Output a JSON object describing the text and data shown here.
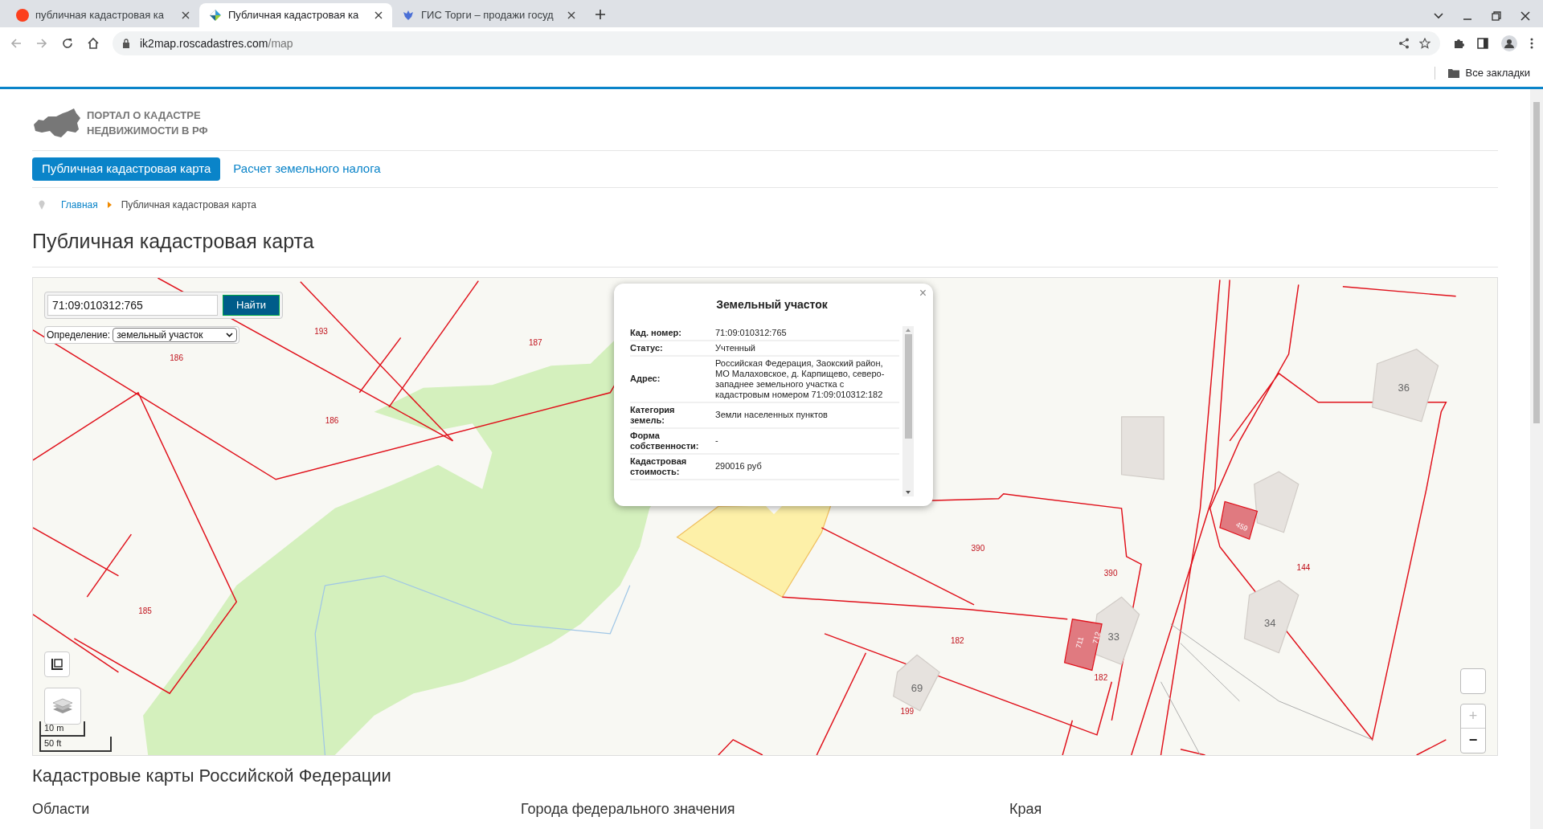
{
  "browser": {
    "tabs": [
      {
        "title": "публичная кадастровая ка",
        "selected": false,
        "kind": "ya"
      },
      {
        "title": "Публичная кадастровая ка",
        "selected": true,
        "kind": "pkk"
      },
      {
        "title": "ГИС Торги – продажи госуд",
        "selected": false,
        "kind": "gis"
      }
    ],
    "url_host": "ik2map.roscadastres.com",
    "url_path": "/map",
    "bookmarks_label": "Все закладки"
  },
  "logo": {
    "line1": "ПОРТАЛ О КАДАСТРЕ",
    "line2": "НЕДВИЖИМОСТИ В РФ"
  },
  "nav": [
    {
      "label": "Публичная кадастровая карта",
      "selected": true
    },
    {
      "label": "Расчет земельного налога",
      "selected": false
    }
  ],
  "breadcrumb": {
    "home": "Главная",
    "current": "Публичная кадастровая карта"
  },
  "page_title": "Публичная кадастровая карта",
  "map": {
    "search": {
      "value": "71:09:010312:765",
      "button": "Найти"
    },
    "definition": {
      "label": "Определение:",
      "value": "земельный участок"
    },
    "labels": [
      {
        "text": "193",
        "kind": "parcel"
      },
      {
        "text": "186",
        "kind": "parcel"
      },
      {
        "text": "187",
        "kind": "parcel"
      },
      {
        "text": "186",
        "kind": "parcel"
      },
      {
        "text": "185",
        "kind": "parcel"
      },
      {
        "text": "390",
        "kind": "parcel"
      },
      {
        "text": "390",
        "kind": "parcel"
      },
      {
        "text": "144",
        "kind": "parcel"
      },
      {
        "text": "182",
        "kind": "parcel"
      },
      {
        "text": "182",
        "kind": "parcel"
      },
      {
        "text": "199",
        "kind": "parcel"
      },
      {
        "text": "69",
        "kind": "building"
      },
      {
        "text": "33",
        "kind": "building"
      },
      {
        "text": "34",
        "kind": "building"
      },
      {
        "text": "36",
        "kind": "building"
      },
      {
        "text": "459",
        "kind": "object"
      },
      {
        "text": "711",
        "kind": "object"
      },
      {
        "text": "712",
        "kind": "object"
      }
    ],
    "scale": {
      "metric": "10 m",
      "imperial": "50 ft"
    },
    "zoom_in": "+",
    "zoom_out": "−",
    "popup": {
      "title": "Земельный участок",
      "close": "×",
      "rows": [
        {
          "label": "Кад. номер:",
          "value": "71:09:010312:765"
        },
        {
          "label": "Статус:",
          "value": "Учтенный"
        },
        {
          "label": "Адрес:",
          "value": "Российская Федерация, Заокский район, МО Малаховское, д. Карпищево, северо-западнее земельного участка с кадастровым номером 71:09:010312:182"
        },
        {
          "label": "Категория земель:",
          "value": "Земли населенных пунктов"
        },
        {
          "label": "Форма собственности:",
          "value": "-"
        },
        {
          "label": "Кадастровая стоимость:",
          "value": "290016 руб"
        }
      ]
    }
  },
  "section_title": "Кадастровые карты Российской Федерации",
  "columns": [
    "Области",
    "Города федерального значения",
    "Края"
  ]
}
